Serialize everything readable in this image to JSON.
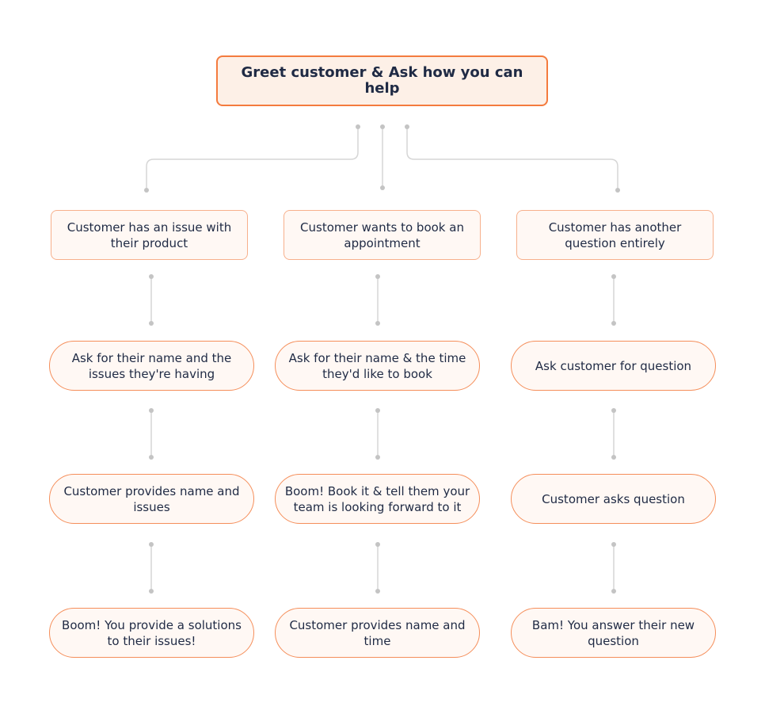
{
  "root": {
    "label": "Greet customer & Ask how you can help"
  },
  "branches": [
    {
      "label": "Customer has an issue with their product",
      "steps": [
        "Ask for their name and the issues they're having",
        "Customer provides name and issues",
        "Boom! You provide a solutions to their issues!"
      ]
    },
    {
      "label": "Customer wants to book an appointment",
      "steps": [
        "Ask for their name & the time they'd like to book",
        "Boom! Book it & tell them your team is looking forward to it",
        "Customer provides name and time"
      ]
    },
    {
      "label": "Customer has another question entirely",
      "steps": [
        "Ask customer for question",
        "Customer asks question",
        "Bam! You answer their new question"
      ]
    }
  ],
  "colors": {
    "accent": "#f47b3e",
    "fill": "#fff8f4",
    "connector": "#d3d3d3",
    "text": "#1f2a44"
  }
}
